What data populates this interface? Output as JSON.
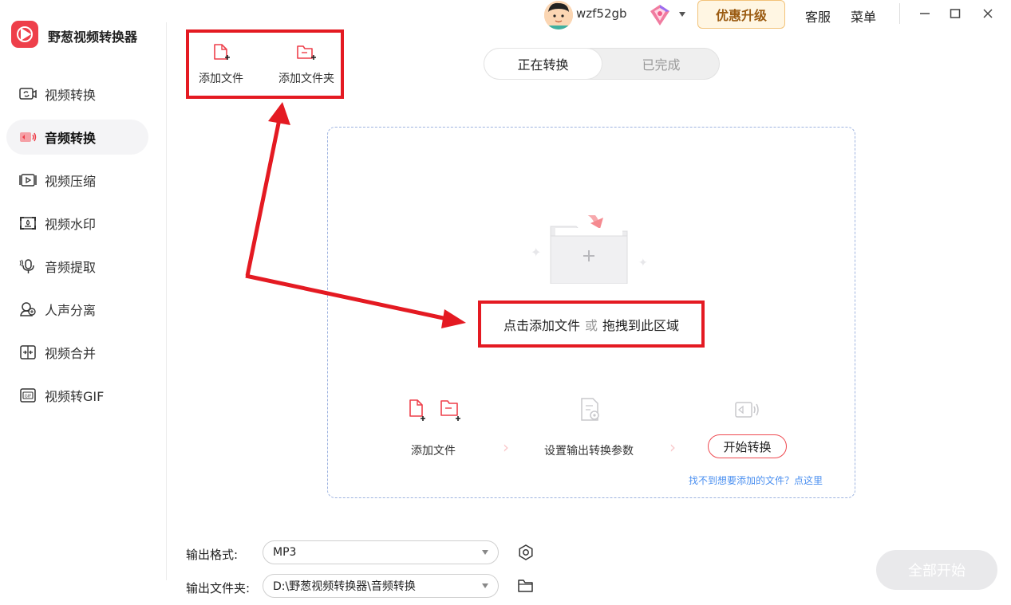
{
  "app": {
    "title": "野葱视频转换器"
  },
  "sidebar": {
    "items": [
      {
        "label": "视频转换",
        "icon": "video-convert-icon"
      },
      {
        "label": "音频转换",
        "icon": "audio-convert-icon",
        "active": true
      },
      {
        "label": "视频压缩",
        "icon": "video-compress-icon"
      },
      {
        "label": "视频水印",
        "icon": "video-watermark-icon"
      },
      {
        "label": "音频提取",
        "icon": "audio-extract-icon"
      },
      {
        "label": "人声分离",
        "icon": "vocal-separate-icon"
      },
      {
        "label": "视频合并",
        "icon": "video-merge-icon"
      },
      {
        "label": "视频转GIF",
        "icon": "video-to-gif-icon"
      }
    ]
  },
  "titlebar": {
    "username": "wzf52gb",
    "upgrade_label": "优惠升级",
    "service_label": "客服",
    "menu_label": "菜单"
  },
  "toolbar": {
    "add_file_label": "添加文件",
    "add_folder_label": "添加文件夹"
  },
  "tabs": [
    {
      "label": "正在转换",
      "active": true
    },
    {
      "label": "已完成",
      "active": false
    }
  ],
  "dropzone": {
    "click_text": "点击添加文件",
    "or_text": "或",
    "drag_text": "拖拽到此区域",
    "steps": {
      "add_file_label": "添加文件",
      "settings_label": "设置输出转换参数",
      "start_label": "开始转换"
    },
    "help_link": "找不到想要添加的文件？点这里"
  },
  "output": {
    "format_label": "输出格式:",
    "format_value": "MP3",
    "folder_label": "输出文件夹:",
    "folder_value": "D:\\野葱视频转换器\\音频转换"
  },
  "start_all_label": "全部开始",
  "colors": {
    "accent": "#ee3f4a",
    "annotation": "#e41a22",
    "link": "#4a8ff0"
  }
}
